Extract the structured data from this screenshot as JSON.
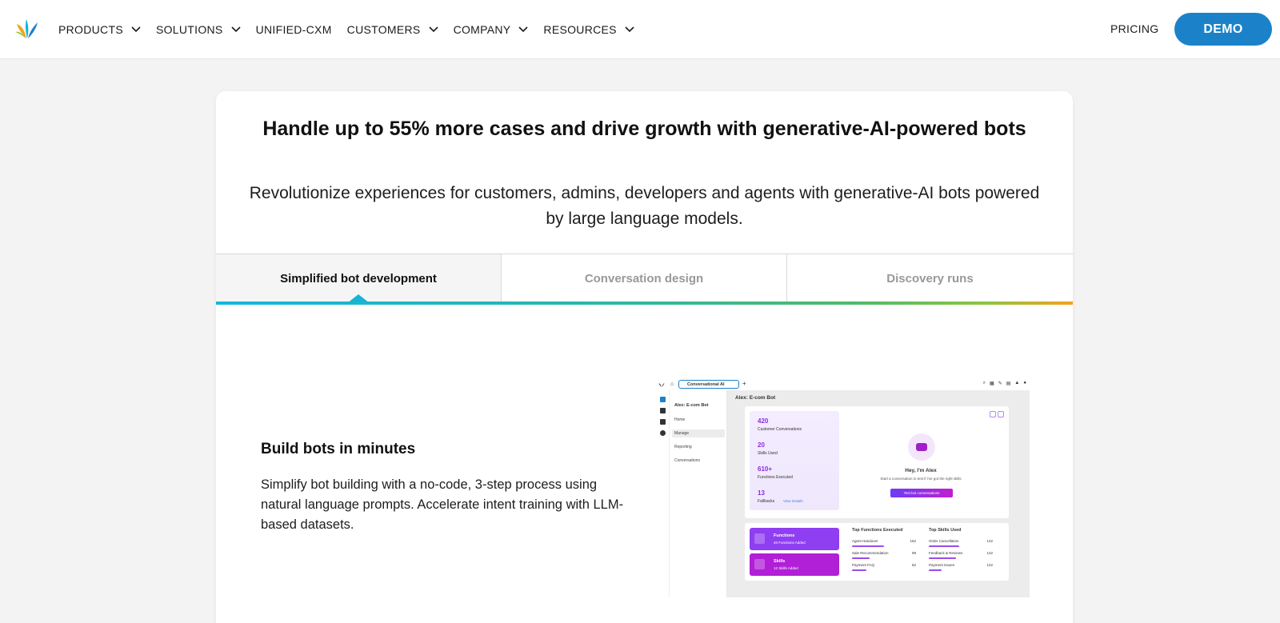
{
  "nav": {
    "items": [
      {
        "label": "PRODUCTS",
        "has_dropdown": true
      },
      {
        "label": "SOLUTIONS",
        "has_dropdown": true
      },
      {
        "label": "UNIFIED-CXM",
        "has_dropdown": false
      },
      {
        "label": "CUSTOMERS",
        "has_dropdown": true
      },
      {
        "label": "COMPANY",
        "has_dropdown": true
      },
      {
        "label": "RESOURCES",
        "has_dropdown": true
      }
    ],
    "pricing": "PRICING",
    "demo": "DEMO"
  },
  "hero": {
    "headline": "Handle up to 55% more cases and drive growth with generative-AI-powered bots",
    "subhead": "Revolutionize experiences for customers, admins, developers and agents with generative-AI bots powered by large language models."
  },
  "tabs": [
    {
      "label": "Simplified bot development",
      "active": true
    },
    {
      "label": "Conversation design",
      "active": false
    },
    {
      "label": "Discovery runs",
      "active": false
    }
  ],
  "feature": {
    "title": "Build bots in minutes",
    "description": "Simplify bot building with a no-code, 3-step process using natural language prompts. Accelerate intent training with LLM-based datasets."
  },
  "mock": {
    "tab_label": "Conversational AI",
    "sidebar_title": "Alex: E-com Bot",
    "sidebar_items": [
      "Home",
      "Manage",
      "Reporting",
      "Conversations"
    ],
    "main_title": "Alex: E-com Bot",
    "stats": [
      {
        "num": "420",
        "label": "Customer Conversations"
      },
      {
        "num": "20",
        "label": "Skills Used"
      },
      {
        "num": "610+",
        "label": "Functions Executed"
      },
      {
        "num": "13",
        "label": "Fallbacks"
      }
    ],
    "view_details": "View Details",
    "bot_greeting": "Hey, I'm Alex",
    "bot_sub": "Start a conversation to test if I've got the right skills",
    "bot_button": "Test bot conversations",
    "functions_title": "Functions",
    "functions_sub": "40 Functions Added",
    "skills_title": "Skills",
    "skills_sub": "12 Skills Added",
    "top_functions_title": "Top Functions Executed",
    "top_functions": [
      {
        "name": "Agent Handover",
        "count": "162"
      },
      {
        "name": "Sale Recommendation",
        "count": "99"
      },
      {
        "name": "Payment FAQ",
        "count": "82"
      }
    ],
    "top_skills_title": "Top Skills Used",
    "top_skills": [
      {
        "name": "Order Cancellation",
        "count": "142"
      },
      {
        "name": "Feedback & Reviews",
        "count": "142"
      },
      {
        "name": "Payment Issues",
        "count": "142"
      }
    ]
  },
  "colors": {
    "brand_blue": "#1b82c9",
    "accent_purple": "#8b2be2",
    "tab_indicator": "#15b4d6"
  }
}
